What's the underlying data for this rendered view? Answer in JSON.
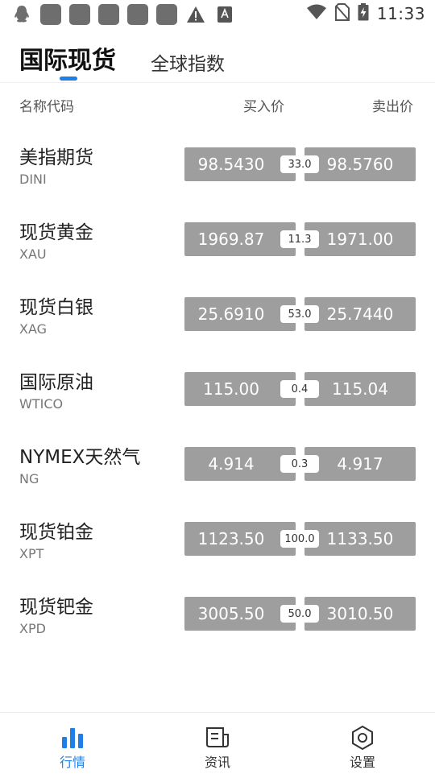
{
  "status_bar": {
    "time": "11:33",
    "notification_icons": [
      "qq-penguin-icon",
      "app-icon",
      "app-icon",
      "app-icon",
      "app-icon",
      "app-icon",
      "warning-icon",
      "keyboard-icon"
    ]
  },
  "tabs": [
    {
      "label": "国际现货",
      "active": true
    },
    {
      "label": "全球指数",
      "active": false
    }
  ],
  "header": {
    "name_col": "名称代码",
    "buy_col": "买入价",
    "sell_col": "卖出价"
  },
  "quotes": [
    {
      "name": "美指期货",
      "code": "DINI",
      "buy": "98.5430",
      "spread": "33.0",
      "sell": "98.5760"
    },
    {
      "name": "现货黄金",
      "code": "XAU",
      "buy": "1969.87",
      "spread": "11.3",
      "sell": "1971.00"
    },
    {
      "name": "现货白银",
      "code": "XAG",
      "buy": "25.6910",
      "spread": "53.0",
      "sell": "25.7440"
    },
    {
      "name": "国际原油",
      "code": "WTICO",
      "buy": "115.00",
      "spread": "0.4",
      "sell": "115.04"
    },
    {
      "name": "NYMEX天然气",
      "code": "NG",
      "buy": "4.914",
      "spread": "0.3",
      "sell": "4.917"
    },
    {
      "name": "现货铂金",
      "code": "XPT",
      "buy": "1123.50",
      "spread": "100.0",
      "sell": "1133.50"
    },
    {
      "name": "现货钯金",
      "code": "XPD",
      "buy": "3005.50",
      "spread": "50.0",
      "sell": "3010.50"
    }
  ],
  "bottom_nav": [
    {
      "label": "行情",
      "icon": "bar-chart-icon",
      "active": true
    },
    {
      "label": "资讯",
      "icon": "news-icon",
      "active": false
    },
    {
      "label": "设置",
      "icon": "settings-hexagon-icon",
      "active": false
    }
  ],
  "colors": {
    "accent": "#1e7fe6",
    "price_box": "#9e9e9e"
  }
}
